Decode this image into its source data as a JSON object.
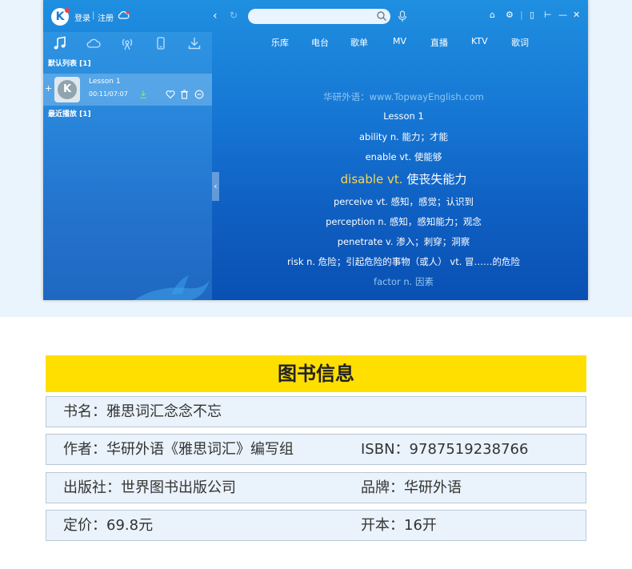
{
  "titlebar": {
    "logo_letter": "K",
    "login_label": "登录",
    "separator": "|",
    "register_label": "注册",
    "back_glyph": "‹",
    "refresh_glyph": "↻",
    "search_placeholder": "",
    "window_buttons": [
      "⌂",
      "⚙",
      "|",
      "▯",
      "⊢",
      "—",
      "✕"
    ]
  },
  "sidebar": {
    "tabs": [
      "music-note-icon",
      "cloud-icon",
      "radio-icon",
      "phone-icon",
      "download-icon"
    ],
    "default_list_label": "默认列表 [1]",
    "songs": [
      {
        "cover_letter": "K",
        "title": "Lesson 1",
        "time": "00:11/07:07"
      }
    ],
    "recent_list_label": "最近播放 [1]",
    "collapse_glyph": "‹"
  },
  "top_nav": [
    "乐库",
    "电台",
    "歌单",
    "MV",
    "直播",
    "KTV",
    "歌词"
  ],
  "lyrics": {
    "lines": [
      "华研外语：www.TopwayEnglish.com",
      "Lesson 1",
      "ability n. 能力；才能",
      "enable vt. 使能够",
      "disable vt. 使丧失能力",
      "perceive vt. 感知，感觉；认识到",
      "perception n.  感知，感知能力；观念",
      "penetrate v. 渗入；刺穿；洞察",
      "risk n. 危险；引起危险的事物（或人） vt. 冒……的危险",
      "factor n. 因素"
    ],
    "current_highlight": "disable vt.",
    "current_rest": " 使丧失能力"
  },
  "book_info": {
    "header": "图书信息",
    "rows": [
      [
        "书名：雅思词汇念念不忘",
        ""
      ],
      [
        "作者：华研外语《雅思词汇》编写组",
        "ISBN：9787519238766"
      ],
      [
        "出版社：世界图书出版公司",
        "品牌：华研外语"
      ],
      [
        "定价：69.8元",
        "开本：16开"
      ]
    ]
  },
  "colors": {
    "app_blue": "#1677d4",
    "highlight": "#ffd54a",
    "header_yellow": "#ffdf00"
  }
}
